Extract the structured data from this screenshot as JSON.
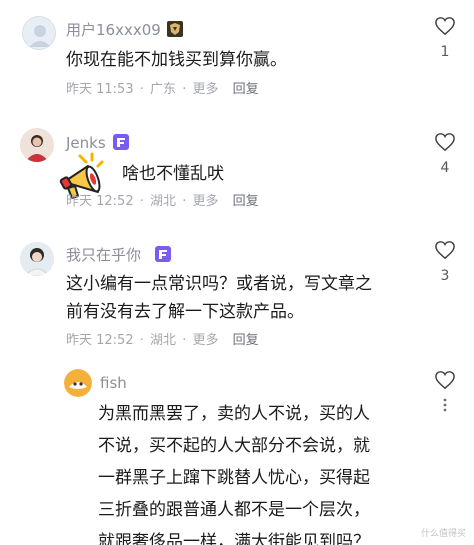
{
  "comments": [
    {
      "username": "用户16xxx09",
      "text": "你现在能不加钱买到算你赢。",
      "time": "昨天 11:53",
      "location": "广东",
      "more": "更多",
      "reply": "回复",
      "likes": "1"
    },
    {
      "username": "Jenks",
      "text": "啥也不懂乱吠",
      "time": "昨天 12:52",
      "location": "湖北",
      "more": "更多",
      "reply": "回复",
      "likes": "4"
    },
    {
      "username": "我只在乎你",
      "text": "这小编有一点常识吗？或者说，写文章之前有没有去了解一下这款产品。",
      "text_lines": [
        "这小编有一点常识吗？或者说，写文章之",
        "前有没有去了解一下这款产品。"
      ],
      "time": "昨天 12:52",
      "location": "湖北",
      "more": "更多",
      "reply": "回复",
      "likes": "3"
    },
    {
      "username": "fish",
      "text_lines": [
        "为黑而黑罢了，卖的人不说，买的人",
        "不说，买不起的人大部分不会说，就",
        "一群黑子上蹿下跳替人忧心，买得起",
        "三折叠的跟普通人都不是一个层次，",
        "就跟奢侈品一样，满大街能见到吗？"
      ]
    }
  ],
  "watermark": "什么值得买",
  "colors": {
    "username": "#8a8f98",
    "meta": "#a4a8ae",
    "badge": "#7a5cf0",
    "text": "#1b1b1b"
  }
}
